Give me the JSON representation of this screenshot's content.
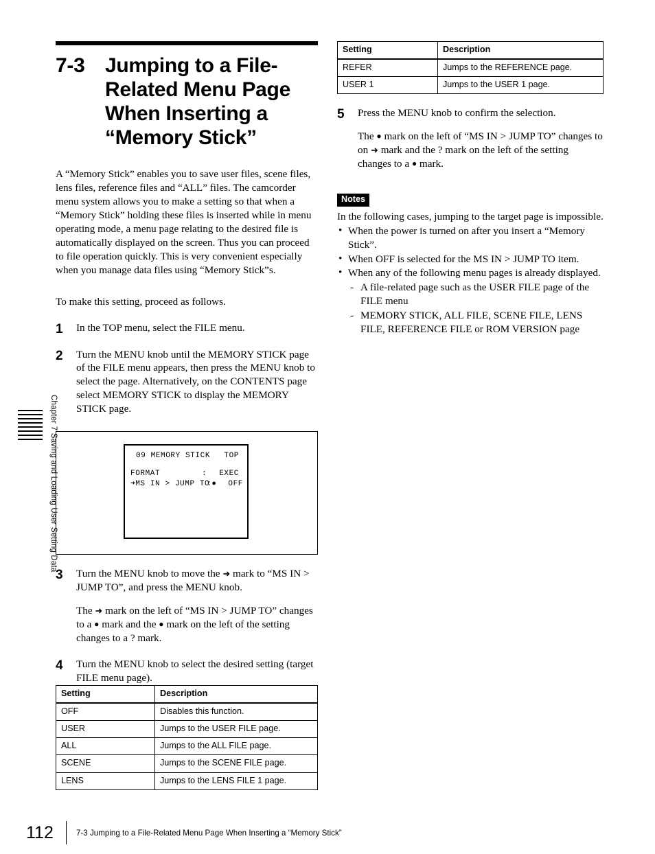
{
  "side_tab": {
    "label": "Chapter 7  Saving and Loading User Setting Data"
  },
  "heading": {
    "number": "7-3",
    "title": "Jumping to a File-Related Menu Page When Inserting a “Memory Stick”"
  },
  "intro": {
    "paragraph_1": "A “Memory Stick” enables you to save user files, scene files, lens files, reference files and “ALL” files. The camcorder menu system allows you to make a setting so that when a “Memory Stick” holding these files is inserted while in menu operating mode, a menu page relating to the desired file is automatically displayed on the screen. Thus you can proceed to file operation quickly. This is very convenient especially when you manage data files using “Memory Stick”s.",
    "paragraph_2": "To make this setting, proceed as follows."
  },
  "steps": {
    "step1": {
      "number": "1",
      "text": "In the TOP menu, select the FILE menu."
    },
    "step2": {
      "number": "2",
      "text": "Turn the MENU knob until the MEMORY STICK page of the FILE menu appears, then press the MENU knob to select the page. Alternatively, on the CONTENTS page select MEMORY STICK to display the MEMORY STICK page."
    },
    "step3": {
      "number": "3",
      "text_a": "Turn the MENU knob to move the ",
      "text_b": " mark to “MS IN > JUMP TO”, and press the MENU knob.",
      "sub_a": "The ",
      "sub_b": " mark on the left of “MS IN > JUMP TO” changes to a ",
      "sub_c": " mark and the ",
      "sub_d": " mark on the left of the setting changes to a ? mark."
    },
    "step4": {
      "number": "4",
      "text": "Turn the MENU knob to select the desired setting (target FILE menu page)."
    },
    "step5": {
      "number": "5",
      "text": "Press the MENU knob to confirm the selection.",
      "sub_a": "The ",
      "sub_b": " mark on the left of “MS IN > JUMP TO” changes to on ",
      "sub_c": " mark and the ? mark on the left of the setting changes to a ",
      "sub_d": " mark."
    }
  },
  "figure": {
    "lcd": {
      "page_number": "09",
      "page_title": "MEMORY STICK",
      "page_corner": "TOP",
      "rows": [
        {
          "cursor": "",
          "name": "FORMAT",
          "colon": ":",
          "value": "EXEC"
        },
        {
          "cursor": "➜",
          "name": "MS IN > JUMP TO",
          "colon": ":●",
          "value": "OFF"
        }
      ]
    }
  },
  "table_left": {
    "headers": [
      "Setting",
      "Description"
    ],
    "rows": [
      [
        "OFF",
        "Disables this function."
      ],
      [
        "USER",
        "Jumps to the USER FILE page."
      ],
      [
        "ALL",
        "Jumps to the ALL FILE page."
      ],
      [
        "SCENE",
        "Jumps to the SCENE FILE page."
      ],
      [
        "LENS",
        "Jumps to the LENS FILE 1 page."
      ]
    ]
  },
  "table_right": {
    "headers": [
      "Setting",
      "Description"
    ],
    "rows": [
      [
        "REFER",
        "Jumps to the REFERENCE page."
      ],
      [
        "USER 1",
        "Jumps to the USER 1 page."
      ]
    ]
  },
  "notes": {
    "badge": "Notes",
    "intro": "In the following cases, jumping to the target page is impossible.",
    "items": [
      "When the power is turned on after you insert a “Memory Stick”.",
      "When OFF is selected for the MS IN > JUMP TO item.",
      "When any of the following menu pages is already displayed."
    ],
    "subitems": [
      "A file-related page such as the USER FILE page of the FILE menu",
      "MEMORY STICK, ALL FILE, SCENE FILE, LENS FILE, REFERENCE FILE or ROM VERSION page"
    ],
    "bullet_glyph": "•",
    "dash_glyph": "-"
  },
  "marks": {
    "arrow": "➜",
    "dot": "●"
  },
  "footer": {
    "page_number": "112",
    "text": "7-3 Jumping to a File-Related Menu Page When Inserting a “Memory Stick”"
  }
}
